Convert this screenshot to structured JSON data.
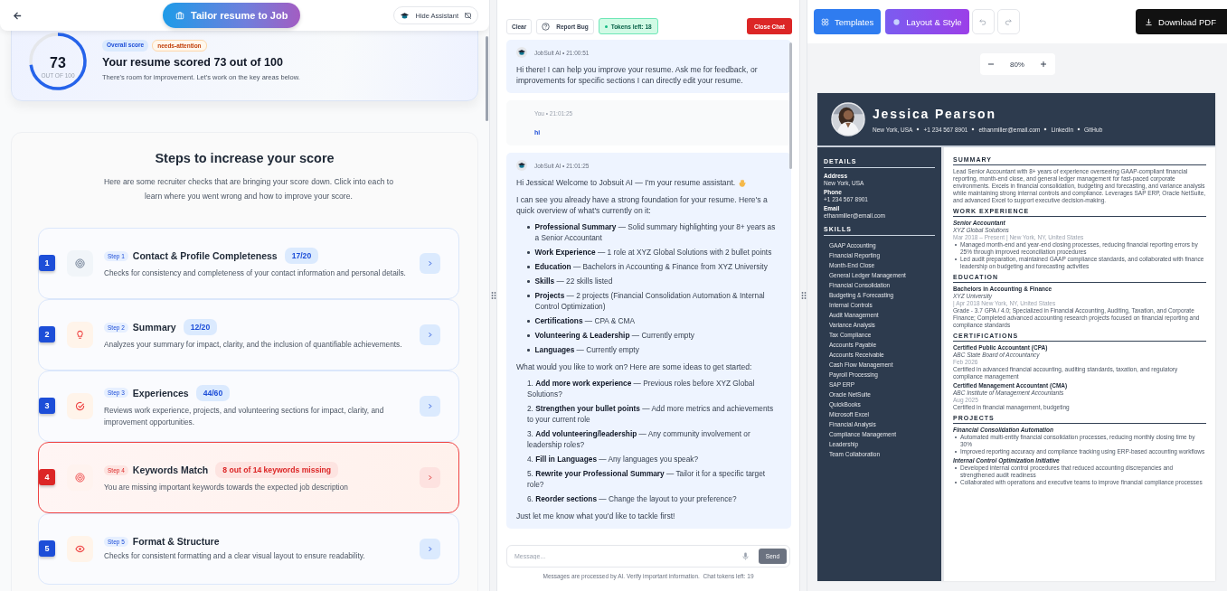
{
  "header": {
    "tailor_button": "Tailor resume to Job",
    "hide_button": "Hide Assistant"
  },
  "score": {
    "value": "73",
    "out_of": "OUT OF 100",
    "badges": [
      "Overall score",
      "needs-attention"
    ],
    "title": "Your resume scored 73 out of 100",
    "subtitle": "There's room for improvement. Let's work on the key areas below."
  },
  "steps_card": {
    "title": "Steps to increase your score",
    "intro": "Here are some recruiter checks that are bringing your score down. Click into each to learn where you went wrong and how to improve your score.",
    "steps": [
      {
        "number": "1",
        "step": "Step 1",
        "title": "Contact & Profile Completeness",
        "score": "17/20",
        "description": "Checks for consistency and completeness of your contact information and personal details.",
        "kind": "score"
      },
      {
        "number": "2",
        "step": "Step 2",
        "title": "Summary",
        "score": "12/20",
        "description": "Analyzes your summary for impact, clarity, and the inclusion of quantifiable achievements.",
        "kind": "score"
      },
      {
        "number": "3",
        "step": "Step 3",
        "title": "Experiences",
        "score": "44/60",
        "description": "Reviews work experience, projects, and volunteering sections for impact, clarity, and improvement opportunities.",
        "kind": "score"
      },
      {
        "number": "4",
        "step": "Step 4",
        "title": "Keywords Match",
        "score": "8 out of 14 keywords missing",
        "description": "You are missing important keywords towards the expected job description",
        "kind": "alert"
      },
      {
        "number": "5",
        "step": "Step 5",
        "title": "Format & Structure",
        "description": "Checks for consistent formatting and a clear visual layout to ensure readability.",
        "kind": "plain"
      }
    ]
  },
  "chat": {
    "toolbar": {
      "clear": "Clear",
      "report": "Report Bug",
      "tokens": "Tokens left: 18",
      "close": "Close Chat"
    },
    "messages": [
      {
        "kind": "ai",
        "meta": "JobSuit AI • 21:00:51",
        "blocks": [
          {
            "kind": "p",
            "text": "Hi there! I can help you improve your resume. Ask me for feedback, or improvements for specific sections I can directly edit your resume."
          }
        ]
      },
      {
        "kind": "user",
        "meta": "You • 21:01:25",
        "blocks": [
          {
            "kind": "p",
            "text": "hi"
          }
        ]
      },
      {
        "kind": "ai",
        "meta": "JobSuit AI • 21:01:25",
        "blocks": [
          {
            "kind": "greeting",
            "text": "Hi Jessica! Welcome to Jobsuit AI — I'm your resume assistant."
          },
          {
            "kind": "p",
            "text": "I can see you already have a strong foundation for your resume. Here's a quick overview of what's currently on it:"
          },
          {
            "kind": "ul",
            "items": [
              "**Professional Summary** — Solid summary highlighting your 8+ years as a Senior Accountant",
              "**Work Experience** — 1 role at XYZ Global Solutions with 2 bullet points",
              "**Education** — Bachelors in Accounting & Finance from XYZ University",
              "**Skills** — 22 skills listed",
              "**Projects** — 2 projects (Financial Consolidation Automation & Internal Control Optimization)",
              "**Certifications** — CPA & CMA",
              "**Volunteering & Leadership** — Currently empty",
              "**Languages** — Currently empty"
            ]
          },
          {
            "kind": "p",
            "text": "What would you like to work on? Here are some ideas to get started:"
          },
          {
            "kind": "ol",
            "items": [
              "1. **Add more work experience** — Previous roles before XYZ Global Solutions?",
              "2. **Strengthen your bullet points** — Add more metrics and achievements to your current role",
              "3. **Add volunteering/leadership** — Any community involvement or leadership roles?",
              "4. **Fill in Languages** — Any languages you speak?",
              "5. **Rewrite your Professional Summary** — Tailor it for a specific target role?",
              "6. **Reorder sections** — Change the layout to your preference?"
            ]
          },
          {
            "kind": "p",
            "text": "Just let me know what you'd like to tackle first!"
          }
        ]
      }
    ],
    "input": {
      "placeholder": "Message...",
      "send": "Send"
    },
    "footer": "Messages are processed by AI. Verify important information.  Chat tokens left: 19"
  },
  "editor": {
    "templates": "Templates",
    "layout": "Layout & Style",
    "download": "Download PDF",
    "zoom": "80%"
  },
  "resume": {
    "name": "Jessica Pearson",
    "contacts": [
      "New York, USA",
      "+1 234 567 8901",
      "ethanmiller@email.com",
      "LinkedIn",
      "GitHub"
    ],
    "details_heading": "DETAILS",
    "details": [
      {
        "label": "Address",
        "value": "New York, USA"
      },
      {
        "label": "Phone",
        "value": "+1 234 567 8901"
      },
      {
        "label": "Email",
        "value": "ethanmiller@email.com"
      }
    ],
    "skills_heading": "SKILLS",
    "skills": [
      "GAAP Accounting",
      "Financial Reporting",
      "Month-End Close",
      "General Ledger Management",
      "Financial Consolidation",
      "Budgeting & Forecasting",
      "Internal Controls",
      "Audit Management",
      "Variance Analysis",
      "Tax Compliance",
      "Accounts Payable",
      "Accounts Receivable",
      "Cash Flow Management",
      "Payroll Processing",
      "SAP ERP",
      "Oracle NetSuite",
      "QuickBooks",
      "Microsoft Excel",
      "Financial Analysis",
      "Compliance Management",
      "Leadership",
      "Team Collaboration"
    ],
    "summary_heading": "SUMMARY",
    "summary": "Lead Senior Accountant with 8+ years of experience overseeing GAAP-compliant financial reporting, month-end close, and general ledger management for fast-paced corporate environments. Excels in financial consolidation, budgeting and forecasting, and variance analysis while maintaining strong internal controls and compliance. Leverages SAP ERP, Oracle NetSuite, and advanced Excel to support executive decision-making.",
    "work_heading": "WORK EXPERIENCE",
    "work": [
      {
        "title": "Senior Accountant",
        "company": "XYZ Global Solutions",
        "meta": "Mar 2018 – Present  |  New York, NY, United States",
        "bullets": [
          "Managed month-end and year-end closing processes, reducing financial reporting errors by 25% through improved reconciliation procedures",
          "Led audit preparation, maintained GAAP compliance standards, and collaborated with finance leadership on budgeting and forecasting activities"
        ]
      }
    ],
    "education_heading": "EDUCATION",
    "education": [
      {
        "degree": "Bachelors in Accounting & Finance",
        "school": "XYZ University",
        "meta": "|  Apr 2018 New York, NY, United States",
        "description": "Grade - 3.7 GPA / 4.0; Specialized in Financial Accounting, Auditing, Taxation, and Corporate Finance; Completed advanced accounting research projects focused on financial reporting and compliance standards"
      }
    ],
    "certs_heading": "CERTIFICATIONS",
    "certs": [
      {
        "name": "Certified Public Accountant (CPA)",
        "org": "ABC State Board of Accountancy",
        "date": "Feb 2026",
        "description": "Certified in advanced financial accounting, auditing standards, taxation, and regulatory compliance management"
      },
      {
        "name": "Certified Management Accountant (CMA)",
        "org": "ABC Institute of Management Accountants",
        "date": "Aug 2025",
        "description": "Certified in financial management, budgeting"
      }
    ],
    "projects_heading": "PROJECTS",
    "projects": [
      {
        "name": "Financial Consolidation Automation",
        "bullets": [
          "Automated multi-entity financial consolidation processes, reducing monthly closing time by 30%",
          "Improved reporting accuracy and compliance tracking using ERP-based accounting workflows"
        ]
      },
      {
        "name": "Internal Control Optimization Initiative",
        "bullets": [
          "Developed internal control procedures that reduced accounting discrepancies and strengthened audit readiness",
          "Collaborated with operations and executive teams to improve financial compliance processes"
        ]
      }
    ]
  }
}
